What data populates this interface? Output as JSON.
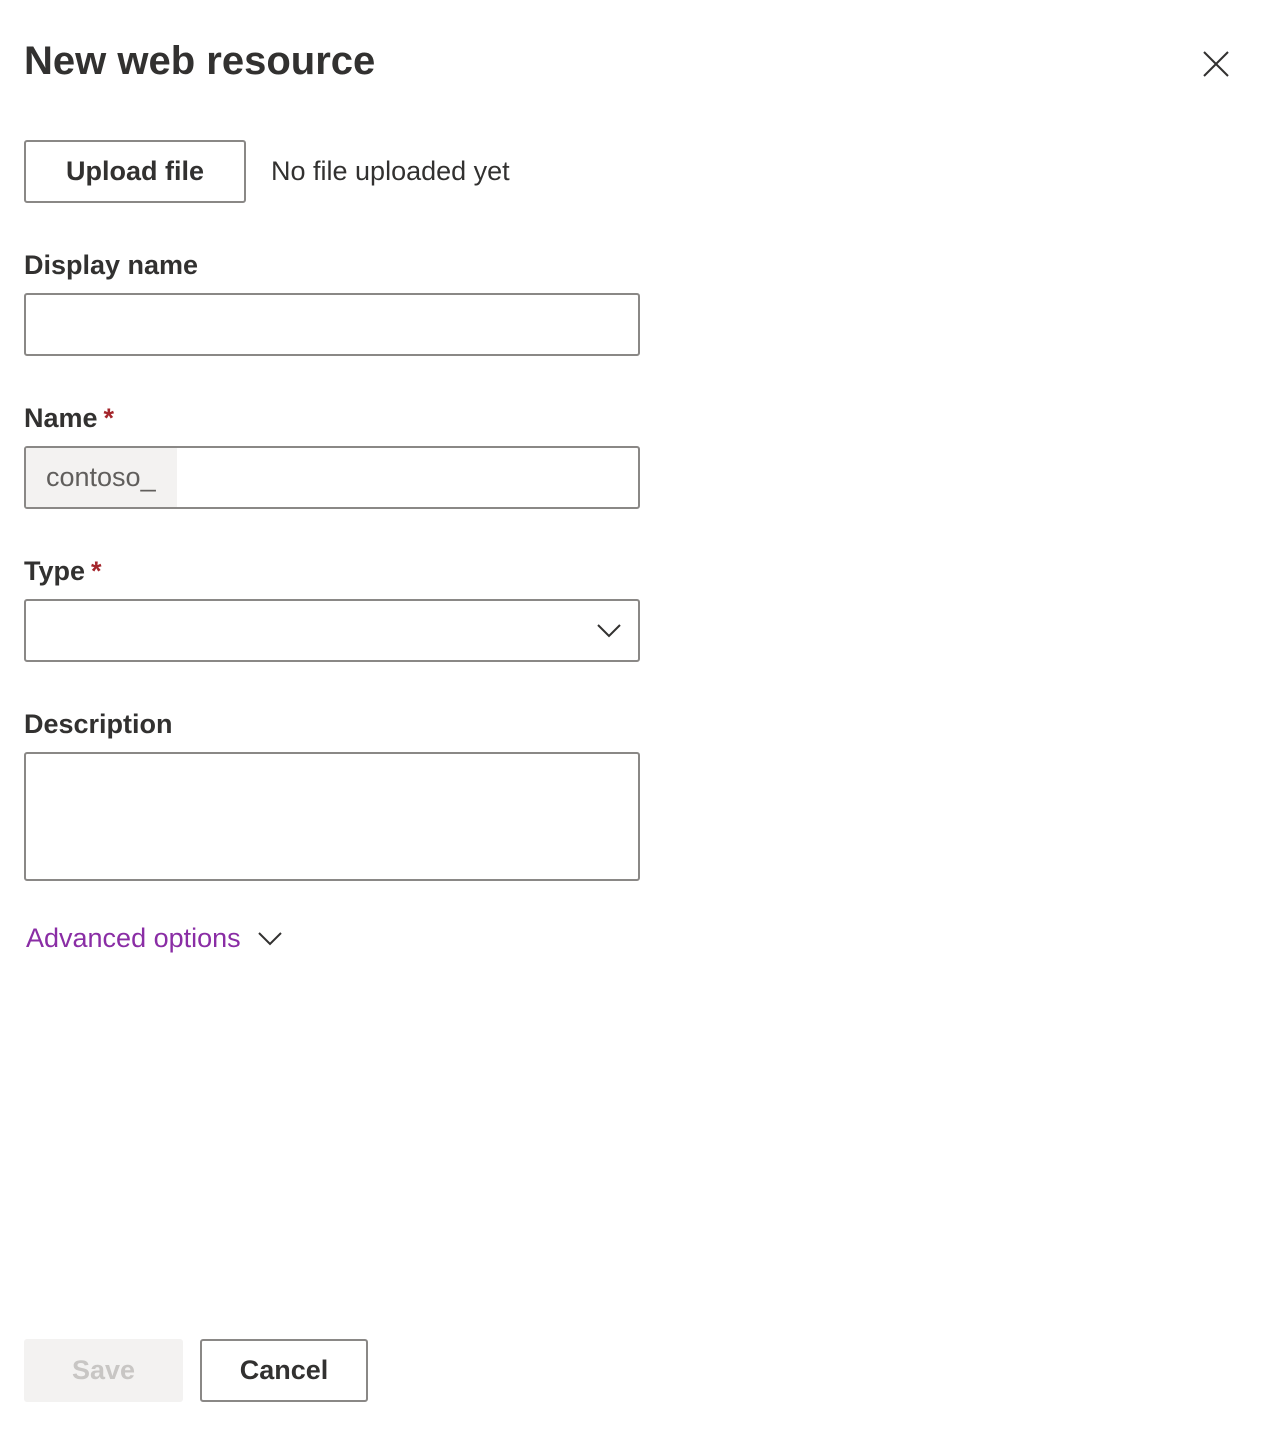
{
  "panel": {
    "title": "New web resource",
    "close_icon": "close-icon"
  },
  "upload": {
    "button_label": "Upload file",
    "status_text": "No file uploaded yet"
  },
  "fields": {
    "display_name": {
      "label": "Display name",
      "value": ""
    },
    "name": {
      "label": "Name",
      "required_marker": "*",
      "prefix": "contoso_",
      "value": ""
    },
    "type": {
      "label": "Type",
      "required_marker": "*",
      "selected_value": "",
      "chevron_icon": "chevron-down-icon"
    },
    "description": {
      "label": "Description",
      "value": ""
    }
  },
  "advanced": {
    "label": "Advanced options",
    "chevron_icon": "chevron-down-icon"
  },
  "footer": {
    "save_label": "Save",
    "cancel_label": "Cancel"
  },
  "colors": {
    "text_primary": "#323130",
    "border": "#8a8886",
    "required": "#a4262c",
    "link": "#8a2da5",
    "disabled_bg": "#f3f2f1",
    "disabled_text": "#c8c6c4",
    "prefix_bg": "#f3f2f1"
  }
}
